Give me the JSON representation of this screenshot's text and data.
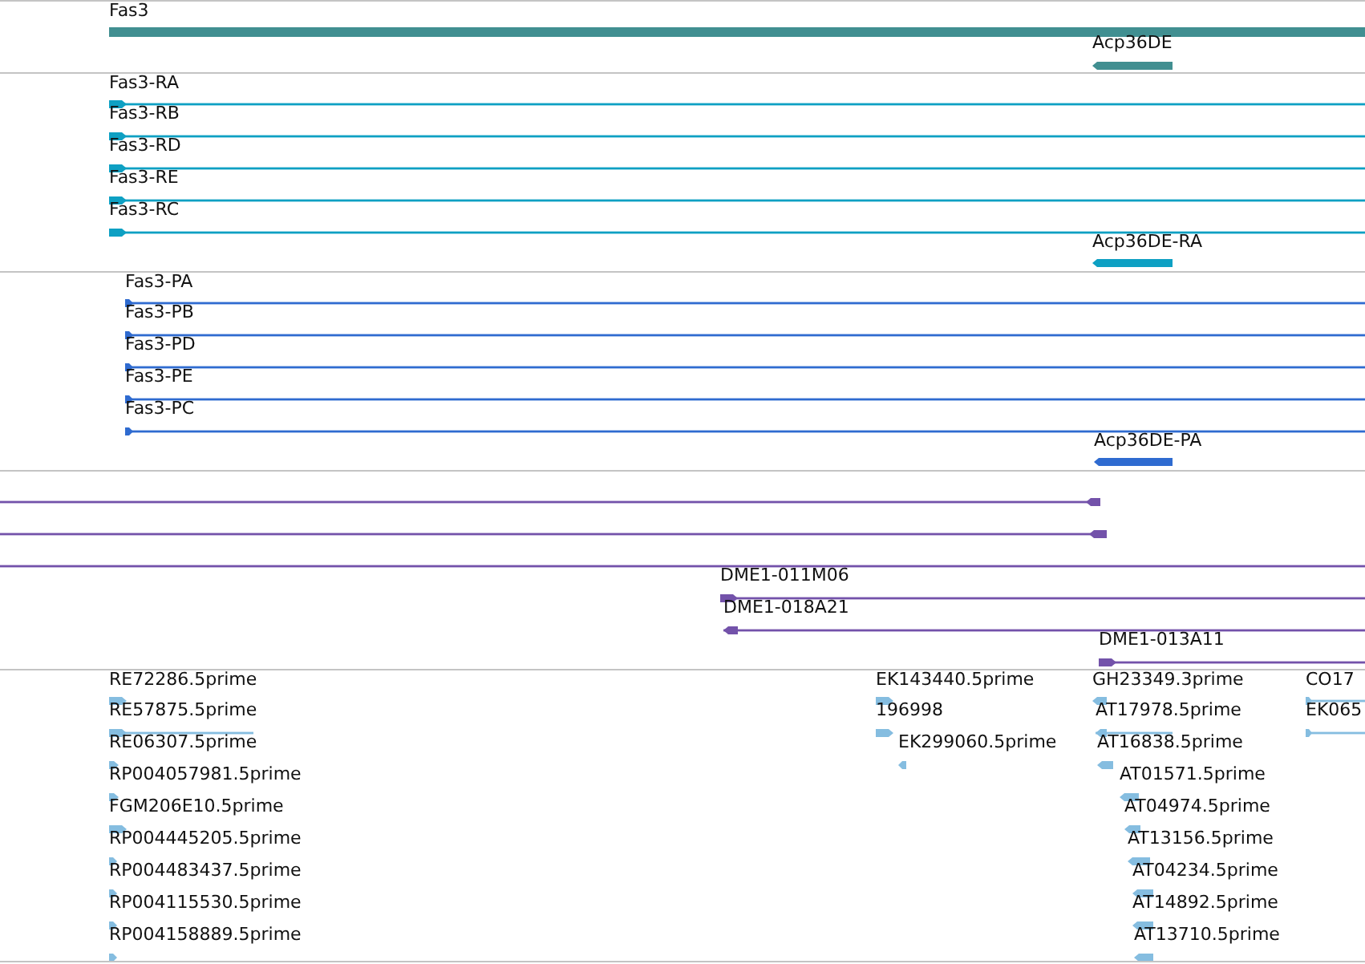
{
  "tracks": [
    {
      "color": "#418f91",
      "features": [
        {
          "label": "Fas3"
        },
        {
          "label": "Acp36DE",
          "reverse": true
        }
      ]
    },
    {
      "color": "#0ea0c3",
      "features": [
        {
          "label": "Fas3-RA",
          "reverse": false
        },
        {
          "label": "Fas3-RB",
          "reverse": false
        },
        {
          "label": "Fas3-RD",
          "reverse": false
        },
        {
          "label": "Fas3-RE",
          "reverse": false
        },
        {
          "label": "Fas3-RC",
          "reverse": false
        },
        {
          "label": "Acp36DE-RA",
          "reverse": true
        }
      ]
    },
    {
      "color": "#2f6bd0",
      "features": [
        {
          "label": "Fas3-PA",
          "reverse": false
        },
        {
          "label": "Fas3-PB",
          "reverse": false
        },
        {
          "label": "Fas3-PD",
          "reverse": false
        },
        {
          "label": "Fas3-PE",
          "reverse": false
        },
        {
          "label": "Fas3-PC",
          "reverse": false
        },
        {
          "label": "Acp36DE-PA",
          "reverse": true
        }
      ]
    },
    {
      "color": "#7352aa",
      "features": [
        {
          "kind": "arrow",
          "reverse": true
        },
        {
          "kind": "arrow",
          "reverse": true
        },
        {
          "kind": "span"
        },
        {
          "kind": "arrow",
          "label": "DME1-011M06",
          "reverse": false
        },
        {
          "kind": "arrow",
          "label": "DME1-018A21",
          "reverse": true
        },
        {
          "kind": "arrow",
          "label": "DME1-013A11",
          "reverse": false
        }
      ]
    },
    {
      "color": "#85bde0",
      "features": [
        {
          "label": "RE72286.5prime",
          "reverse": false
        },
        {
          "label": "RE57875.5prime",
          "reverse": false
        },
        {
          "label": "RE06307.5prime",
          "reverse": false
        },
        {
          "label": "RP004057981.5prime",
          "reverse": false
        },
        {
          "label": "FGM206E10.5prime",
          "reverse": false
        },
        {
          "label": "RP004445205.5prime",
          "reverse": false
        },
        {
          "label": "RP004483437.5prime",
          "reverse": false
        },
        {
          "label": "RP004115530.5prime",
          "reverse": false
        },
        {
          "label": "RP004158889.5prime",
          "reverse": false
        },
        {
          "label": "EK143440.5prime",
          "reverse": false
        },
        {
          "label": "196998",
          "reverse": false
        },
        {
          "label": "EK299060.5prime",
          "reverse": true
        },
        {
          "label": "GH23349.3prime",
          "reverse": true
        },
        {
          "label": "AT17978.5prime",
          "reverse": true
        },
        {
          "label": "AT16838.5prime",
          "reverse": true
        },
        {
          "label": "AT01571.5prime",
          "reverse": true
        },
        {
          "label": "AT04974.5prime",
          "reverse": true
        },
        {
          "label": "AT13156.5prime",
          "reverse": true
        },
        {
          "label": "AT04234.5prime",
          "reverse": true
        },
        {
          "label": "AT14892.5prime",
          "reverse": true
        },
        {
          "label": "AT13710.5prime",
          "reverse": true
        },
        {
          "label": "CO17",
          "reverse": false
        },
        {
          "label": "EK065",
          "reverse": false
        }
      ]
    }
  ]
}
